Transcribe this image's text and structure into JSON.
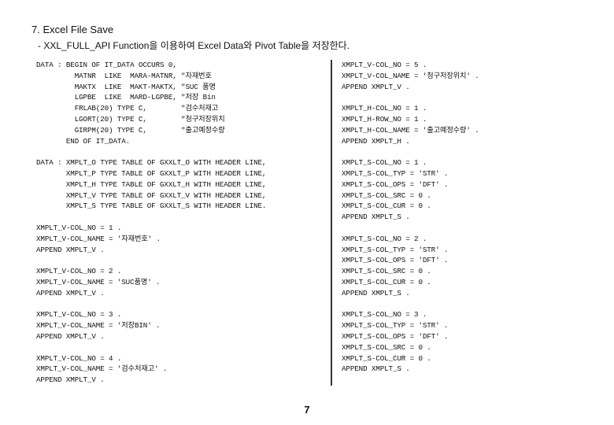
{
  "heading": "7. Excel File Save",
  "subheading": "- XXL_FULL_API Function을 이용하여 Excel Data와 Pivot Table을 저장한다.",
  "code": {
    "left": "DATA : BEGIN OF IT_DATA OCCURS 0,\n         MATNR  LIKE  MARA-MATNR, \"자재번호\n         MAKTX  LIKE  MAKT-MAKTX, \"SUC 품명\n         LGPBE  LIKE  MARD-LGPBE, \"저장 Bin\n         FRLAB(20) TYPE C,        \"검수처재고\n         LGORT(20) TYPE C,        \"청구저장위치\n         GIRPM(20) TYPE C,        \"출고예정수량\n       END OF IT_DATA.\n\nDATA : XMPLT_O TYPE TABLE OF GXXLT_O WITH HEADER LINE,\n       XMPLT_P TYPE TABLE OF GXXLT_P WITH HEADER LINE,\n       XMPLT_H TYPE TABLE OF GXXLT_H WITH HEADER LINE,\n       XMPLT_V TYPE TABLE OF GXXLT_V WITH HEADER LINE,\n       XMPLT_S TYPE TABLE OF GXXLT_S WITH HEADER LINE.\n\nXMPLT_V-COL_NO = 1 .\nXMPLT_V-COL_NAME = '자재번호' .\nAPPEND XMPLT_V .\n\nXMPLT_V-COL_NO = 2 .\nXMPLT_V-COL_NAME = 'SUC품명' .\nAPPEND XMPLT_V .\n\nXMPLT_V-COL_NO = 3 .\nXMPLT_V-COL_NAME = '저장BIN' .\nAPPEND XMPLT_V .\n\nXMPLT_V-COL_NO = 4 .\nXMPLT_V-COL_NAME = '검수처재고' .\nAPPEND XMPLT_V .",
    "right": "XMPLT_V-COL_NO = 5 .\nXMPLT_V-COL_NAME = '청구저장위치' .\nAPPEND XMPLT_V .\n\nXMPLT_H-COL_NO = 1 .\nXMPLT_H-ROW_NO = 1 .\nXMPLT_H-COL_NAME = '출고예정수량' .\nAPPEND XMPLT_H .\n\nXMPLT_S-COL_NO = 1 .\nXMPLT_S-COL_TYP = 'STR' .\nXMPLT_S-COL_OPS = 'DFT' .\nXMPLT_S-COL_SRC = 0 .\nXMPLT_S-COL_CUR = 0 .\nAPPEND XMPLT_S .\n\nXMPLT_S-COL_NO = 2 .\nXMPLT_S-COL_TYP = 'STR' .\nXMPLT_S-COL_OPS = 'DFT' .\nXMPLT_S-COL_SRC = 0 .\nXMPLT_S-COL_CUR = 0 .\nAPPEND XMPLT_S .\n\nXMPLT_S-COL_NO = 3 .\nXMPLT_S-COL_TYP = 'STR' .\nXMPLT_S-COL_OPS = 'DFT' .\nXMPLT_S-COL_SRC = 0 .\nXMPLT_S-COL_CUR = 0 .\nAPPEND XMPLT_S ."
  },
  "pageNumber": "7"
}
